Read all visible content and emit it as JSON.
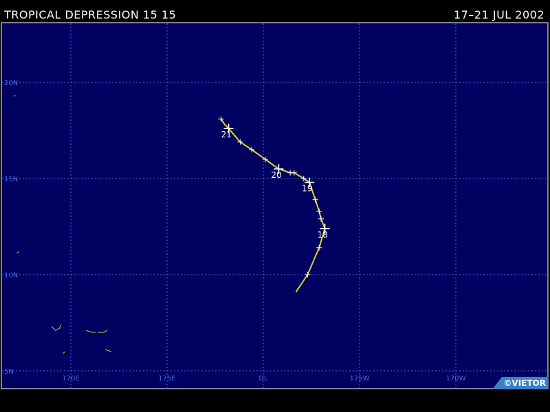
{
  "header": {
    "title": "TROPICAL DEPRESSION 15 15",
    "dates": "17–21 JUL 2002"
  },
  "map": {
    "projection": "lat-lon",
    "lon_range_east": [
      166.9,
      191.6
    ],
    "lat_range": [
      4.95,
      17.35
    ],
    "lat_note": "upper lat limit approximate",
    "lon_labels": [
      {
        "lon": 170,
        "text": "170E"
      },
      {
        "lon": 175,
        "text": "175E"
      },
      {
        "lon": 180,
        "text": "DL"
      },
      {
        "lon": 185,
        "text": "175W"
      },
      {
        "lon": 190,
        "text": "170W"
      }
    ],
    "lat_labels": [
      {
        "lat": 20,
        "text": "20N"
      },
      {
        "lat": 15,
        "text": "15N"
      },
      {
        "lat": 10,
        "text": "10N"
      },
      {
        "lat": 5,
        "text": "5N"
      }
    ],
    "colors": {
      "ocean": "#000060",
      "grid": "#4a6be8",
      "track": "#e0d030",
      "land": "#e0d030",
      "labels": "#4a6be8",
      "day_labels": "#ffffff"
    }
  },
  "track": {
    "points_lon_lat": [
      [
        181.7,
        9.1
      ],
      [
        182.3,
        10.0
      ],
      [
        182.9,
        11.4
      ],
      [
        183.2,
        12.4
      ],
      [
        183.0,
        12.9
      ],
      [
        182.9,
        13.3
      ],
      [
        182.7,
        13.9
      ],
      [
        182.4,
        14.8
      ],
      [
        182.1,
        15.0
      ],
      [
        181.6,
        15.3
      ],
      [
        181.4,
        15.3
      ],
      [
        180.8,
        15.5
      ],
      [
        180.1,
        16.0
      ],
      [
        179.4,
        16.5
      ],
      [
        178.8,
        16.9
      ],
      [
        178.2,
        17.6
      ],
      [
        178.0,
        17.8
      ],
      [
        177.8,
        18.1
      ]
    ],
    "six_hour_marks": [
      [
        182.3,
        10.0
      ],
      [
        182.9,
        11.4
      ],
      [
        183.0,
        12.9
      ],
      [
        182.9,
        13.3
      ],
      [
        182.7,
        13.9
      ],
      [
        182.1,
        15.0
      ],
      [
        181.6,
        15.3
      ],
      [
        181.4,
        15.3
      ],
      [
        180.1,
        16.0
      ],
      [
        179.4,
        16.5
      ],
      [
        178.8,
        16.9
      ],
      [
        177.8,
        18.1
      ]
    ],
    "day_marks": [
      {
        "day": "18",
        "lon": 183.2,
        "lat": 12.4
      },
      {
        "day": "19",
        "lon": 182.4,
        "lat": 14.8
      },
      {
        "day": "20",
        "lon": 180.8,
        "lat": 15.5
      },
      {
        "day": "21",
        "lon": 178.2,
        "lat": 17.6
      }
    ]
  },
  "islands_lon_lat": [
    [
      [
        169.0,
        7.3
      ],
      [
        169.2,
        7.1
      ],
      [
        169.4,
        7.2
      ],
      [
        169.5,
        7.4
      ]
    ],
    [
      [
        170.8,
        7.1
      ],
      [
        171.1,
        7.0
      ],
      [
        171.3,
        7.0
      ]
    ],
    [
      [
        171.4,
        7.0
      ],
      [
        171.7,
        7.0
      ],
      [
        171.9,
        7.1
      ]
    ],
    [
      [
        171.8,
        6.1
      ],
      [
        172.1,
        6.0
      ]
    ],
    [
      [
        169.7,
        6.0
      ],
      [
        169.6,
        5.9
      ]
    ],
    [
      [
        167.3,
        11.2
      ],
      [
        167.2,
        11.1
      ]
    ],
    [
      [
        167.1,
        19.3
      ]
    ]
  ],
  "credit": "©VIETOR"
}
